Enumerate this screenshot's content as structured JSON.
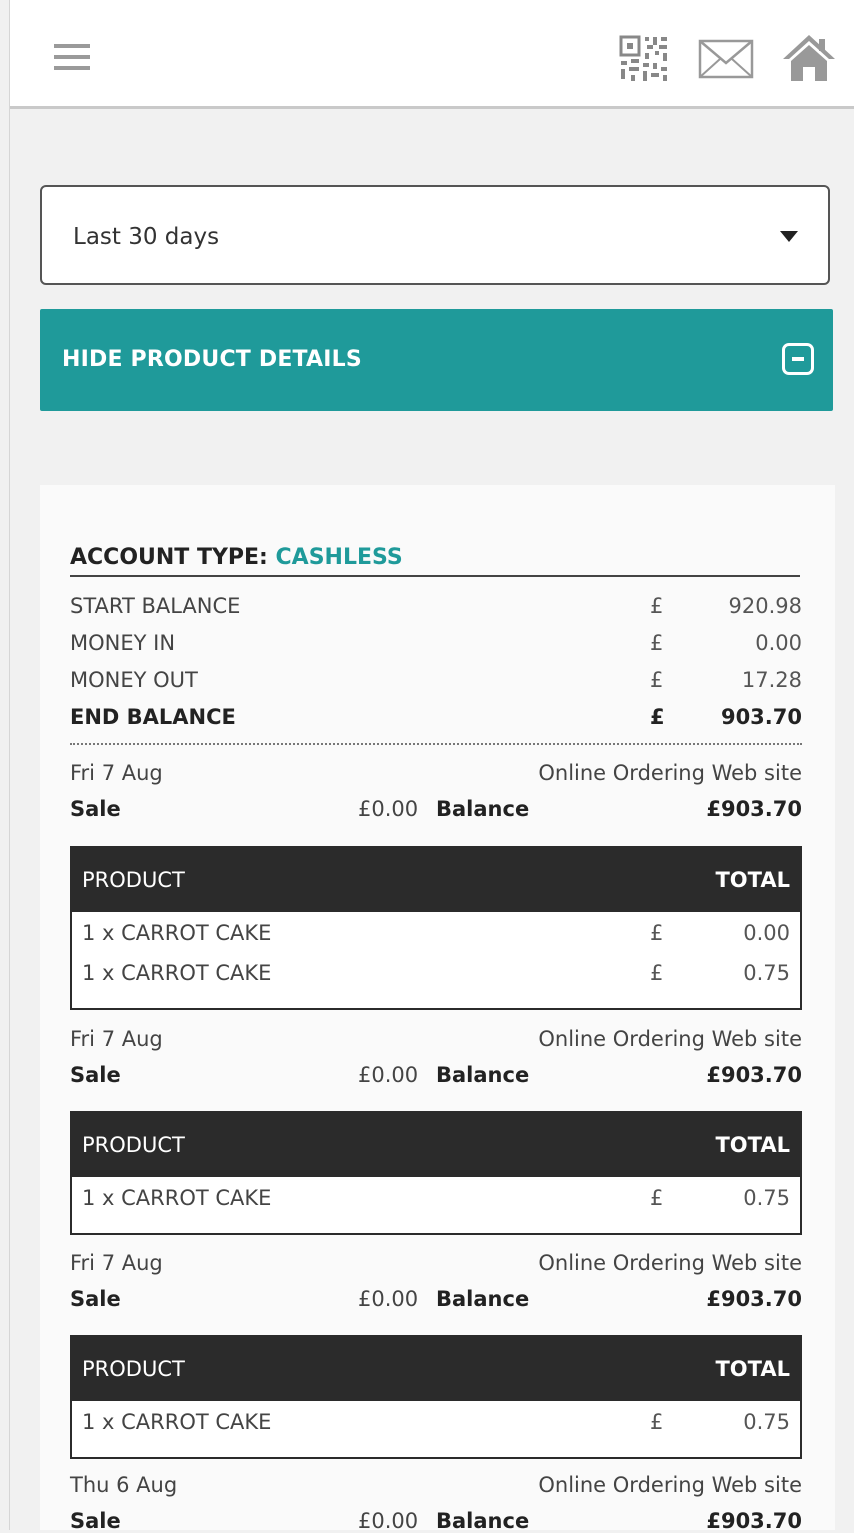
{
  "header": {
    "menu_icon": "hamburger-icon",
    "icons": [
      "qr-code-icon",
      "mail-icon",
      "home-icon"
    ]
  },
  "filter": {
    "selected": "Last 30 days"
  },
  "toggle": {
    "label": "HIDE PRODUCT DETAILS",
    "icon": "minus-box-icon"
  },
  "account": {
    "title_label": "ACCOUNT TYPE:",
    "title_value": "CASHLESS",
    "summary": [
      {
        "label": "START BALANCE",
        "currency": "£",
        "value": "920.98"
      },
      {
        "label": "MONEY IN",
        "currency": "£",
        "value": "0.00"
      },
      {
        "label": "MONEY OUT",
        "currency": "£",
        "value": "17.28"
      },
      {
        "label": "END BALANCE",
        "currency": "£",
        "value": "903.70"
      }
    ]
  },
  "transactions": [
    {
      "date": "Fri 7 Aug",
      "source": "Online Ordering Web site",
      "type": "Sale",
      "amount": "£0.00",
      "balance_label": "Balance",
      "balance": "£903.70",
      "product_header": "PRODUCT",
      "total_header": "TOTAL",
      "items": [
        {
          "name": "1 x CARROT CAKE",
          "currency": "£",
          "total": "0.00"
        },
        {
          "name": "1 x CARROT CAKE",
          "currency": "£",
          "total": "0.75"
        }
      ]
    },
    {
      "date": "Fri 7 Aug",
      "source": "Online Ordering Web site",
      "type": "Sale",
      "amount": "£0.00",
      "balance_label": "Balance",
      "balance": "£903.70",
      "product_header": "PRODUCT",
      "total_header": "TOTAL",
      "items": [
        {
          "name": "1 x CARROT CAKE",
          "currency": "£",
          "total": "0.75"
        }
      ]
    },
    {
      "date": "Fri 7 Aug",
      "source": "Online Ordering Web site",
      "type": "Sale",
      "amount": "£0.00",
      "balance_label": "Balance",
      "balance": "£903.70",
      "product_header": "PRODUCT",
      "total_header": "TOTAL",
      "items": [
        {
          "name": "1 x CARROT CAKE",
          "currency": "£",
          "total": "0.75"
        }
      ]
    },
    {
      "date": "Thu 6 Aug",
      "source": "Online Ordering Web site",
      "type": "Sale",
      "amount": "£0.00",
      "balance_label": "Balance",
      "balance": "£903.70"
    }
  ]
}
